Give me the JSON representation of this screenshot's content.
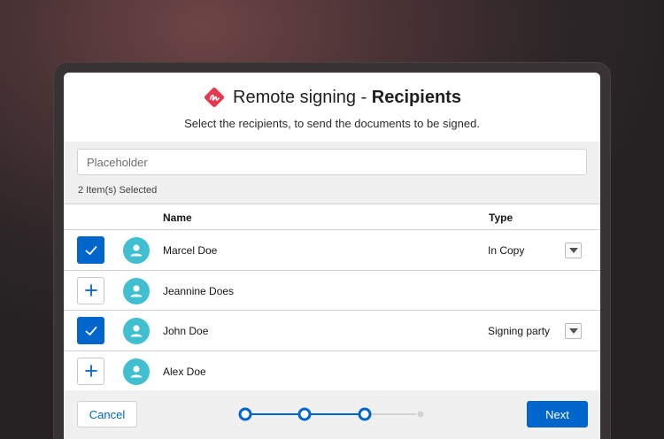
{
  "header": {
    "title_prefix": "Remote signing - ",
    "title_bold": "Recipients",
    "subtitle": "Select the recipients, to send the documents to be signed.",
    "logo_icon": "signature-logo-icon",
    "logo_color": "#e8364f"
  },
  "search": {
    "placeholder": "Placeholder",
    "value": ""
  },
  "selection": {
    "count_label": "2 Item(s) Selected"
  },
  "table": {
    "columns": [
      "Name",
      "Type"
    ],
    "rows": [
      {
        "name": "Marcel Doe",
        "type": "In Copy",
        "selected": true
      },
      {
        "name": "Jeannine Does",
        "type": "",
        "selected": false
      },
      {
        "name": "John Doe",
        "type": "Signing party",
        "selected": true
      },
      {
        "name": "Alex Doe",
        "type": "",
        "selected": false
      }
    ]
  },
  "footer": {
    "cancel_label": "Cancel",
    "next_label": "Next",
    "stepper": {
      "total_steps": 4,
      "completed_steps": 3
    }
  },
  "colors": {
    "primary": "#0066cc",
    "avatar": "#3fbfcf",
    "stepper_inactive": "#d2d2d2"
  }
}
